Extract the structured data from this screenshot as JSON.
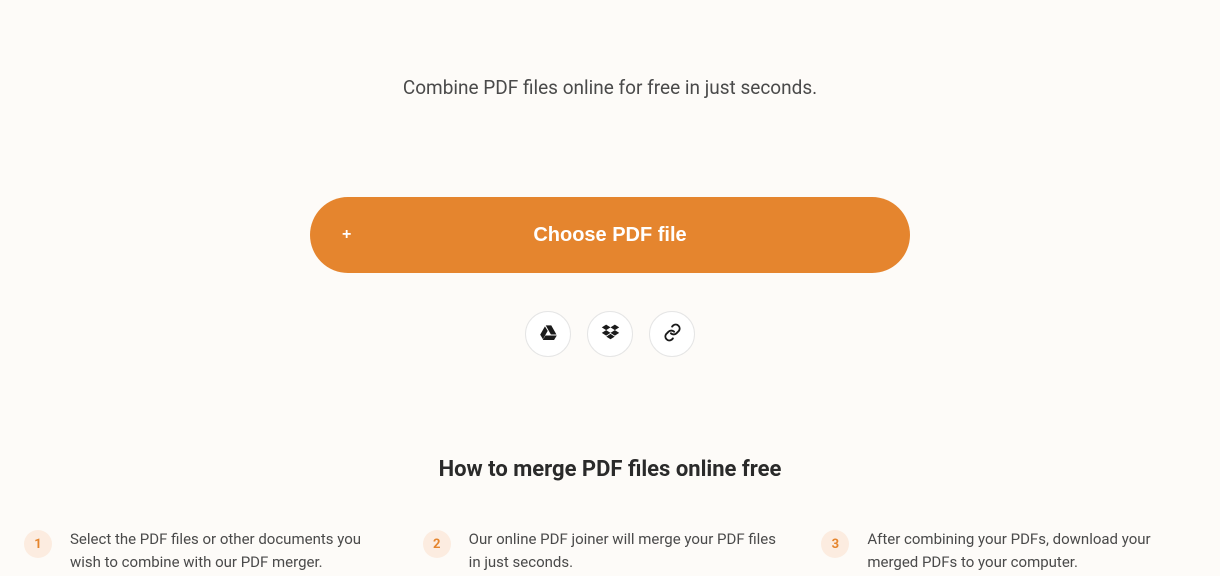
{
  "subtitle": "Combine PDF files online for free in just seconds.",
  "chooseBtn": {
    "plus": "+",
    "label": "Choose PDF file"
  },
  "sectionTitle": "How to merge PDF files online free",
  "steps": [
    {
      "num": "1",
      "text": "Select the PDF files or other documents you wish to combine with our PDF merger."
    },
    {
      "num": "2",
      "text": "Our online PDF joiner will merge your PDF files in just seconds."
    },
    {
      "num": "3",
      "text": "After combining your PDFs, download your merged PDFs to your computer."
    }
  ]
}
